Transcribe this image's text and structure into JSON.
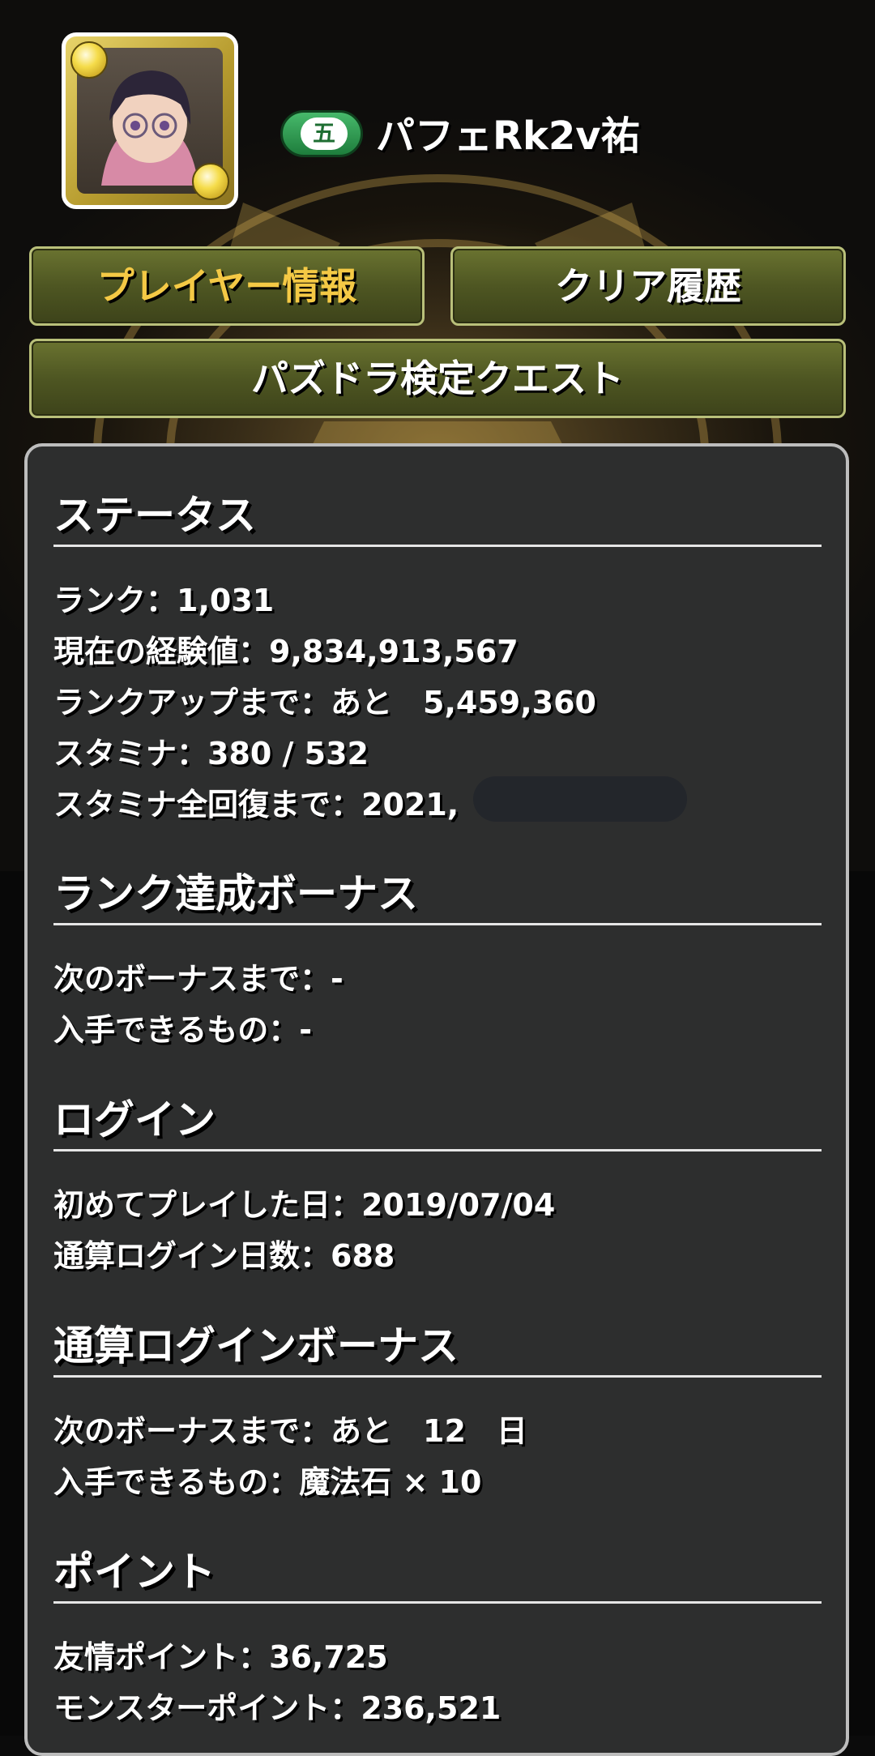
{
  "player": {
    "rank_badge": "五",
    "name": "パフェRk2v祐"
  },
  "tabs": {
    "player_info": "プレイヤー情報",
    "clear_history": "クリア履歴",
    "quest": "パズドラ検定クエスト"
  },
  "sections": {
    "status": {
      "heading": "ステータス",
      "rank": "ランク：1,031",
      "exp": "現在の経験値：9,834,913,567",
      "rankup": "ランクアップまで：あと　5,459,360",
      "stamina": "スタミナ：380 / 532",
      "stamina_full": "スタミナ全回復まで：2021,"
    },
    "rank_bonus": {
      "heading": "ランク達成ボーナス",
      "next": "次のボーナスまで：-",
      "reward": "入手できるもの：-"
    },
    "login": {
      "heading": "ログイン",
      "first_play": "初めてプレイした日：2019/07/04",
      "total_days": "通算ログイン日数：688"
    },
    "login_bonus": {
      "heading": "通算ログインボーナス",
      "next": "次のボーナスまで：あと　12　日",
      "reward": "入手できるもの：魔法石 × 10"
    },
    "points": {
      "heading": "ポイント",
      "friend": "友情ポイント：36,725",
      "monster": "モンスターポイント：236,521"
    }
  },
  "colors": {
    "active_tab_text": "#f4c945",
    "tab_fill": "#4e5622",
    "panel_bg": "#2d2e2e",
    "rank_badge": "#1e7d3c"
  },
  "icons": [
    "avatar",
    "light-orb-icon"
  ]
}
